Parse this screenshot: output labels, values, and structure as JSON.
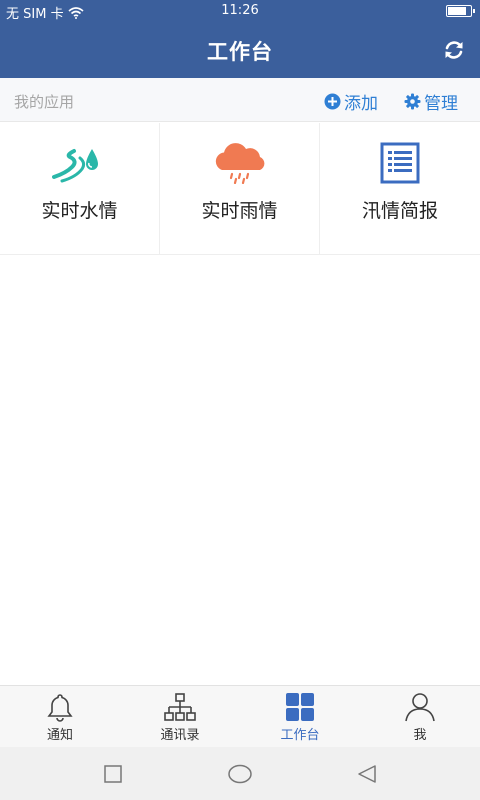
{
  "status_bar": {
    "carrier": "无 SIM 卡",
    "time": "11:26",
    "battery_level": 0.85,
    "icons": [
      "wifi-icon",
      "battery-icon"
    ]
  },
  "app_bar": {
    "title": "工作台",
    "refresh_icon": "refresh-icon"
  },
  "section": {
    "title": "我的应用",
    "add_label": "添加",
    "manage_label": "管理",
    "add_icon": "plus-circle-icon",
    "manage_icon": "gear-icon",
    "accent_color": "#2f7fd4"
  },
  "apps": [
    {
      "label": "实时水情",
      "icon": "water-drop-river-icon",
      "color": "#2ab7a9"
    },
    {
      "label": "实时雨情",
      "icon": "rain-cloud-icon",
      "color": "#f07a52"
    },
    {
      "label": "汛情简报",
      "icon": "report-list-icon",
      "color": "#3b6cc0"
    }
  ],
  "tabs": [
    {
      "label": "通知",
      "icon": "bell-icon",
      "active": false
    },
    {
      "label": "通讯录",
      "icon": "org-chart-icon",
      "active": false
    },
    {
      "label": "工作台",
      "icon": "grid-icon",
      "active": true
    },
    {
      "label": "我",
      "icon": "user-icon",
      "active": false
    }
  ],
  "nav_bar": {
    "icons": [
      "square-recent-icon",
      "circle-home-icon",
      "triangle-back-icon"
    ]
  },
  "colors": {
    "primary": "#3b5f9c",
    "tab_active": "#3b6cc0"
  }
}
